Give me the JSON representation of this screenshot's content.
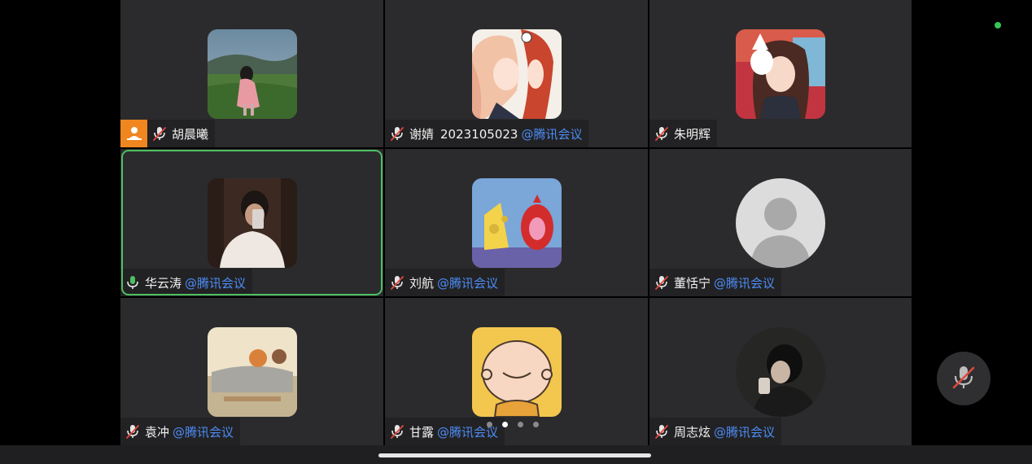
{
  "participants": [
    {
      "name": "胡晨曦",
      "extra": "",
      "tag": "",
      "mic": "muted",
      "host": true,
      "active": false,
      "avatar": "photo-girl-field"
    },
    {
      "name": "谢婧",
      "extra": "2023105023",
      "tag": "@腾讯会议",
      "mic": "muted",
      "host": false,
      "active": false,
      "avatar": "anime-pink-hair"
    },
    {
      "name": "朱明辉",
      "extra": "",
      "tag": "",
      "mic": "muted",
      "host": false,
      "active": false,
      "avatar": "anime-fox-mask"
    },
    {
      "name": "华云涛",
      "extra": "",
      "tag": "@腾讯会议",
      "mic": "on",
      "host": false,
      "active": true,
      "avatar": "photo-mirror-selfie"
    },
    {
      "name": "刘航",
      "extra": "",
      "tag": "@腾讯会议",
      "mic": "muted",
      "host": false,
      "active": false,
      "avatar": "cartoon-cheese-sausage"
    },
    {
      "name": "董恬宁",
      "extra": "",
      "tag": "@腾讯会议",
      "mic": "muted",
      "host": false,
      "active": false,
      "avatar": "default-person"
    },
    {
      "name": "袁冲",
      "extra": "",
      "tag": "@腾讯会议",
      "mic": "muted",
      "host": false,
      "active": false,
      "avatar": "illustration-sleeping"
    },
    {
      "name": "甘露",
      "extra": "",
      "tag": "@腾讯会议",
      "mic": "muted",
      "host": false,
      "active": false,
      "avatar": "cartoon-bald-kid"
    },
    {
      "name": "周志炫",
      "extra": "",
      "tag": "@腾讯会议",
      "mic": "muted",
      "host": false,
      "active": false,
      "avatar": "photo-dark-portrait"
    }
  ],
  "pagination": {
    "total": 4,
    "current": 1
  },
  "colors": {
    "active_border": "#4fbf63",
    "tag": "#4d8cf5",
    "host": "#f0861f",
    "status": "#34c759"
  },
  "icons": {
    "muted": "mic-off-icon",
    "on": "mic-on-icon",
    "host": "host-person-icon",
    "mute_button": "mic-off-icon"
  }
}
